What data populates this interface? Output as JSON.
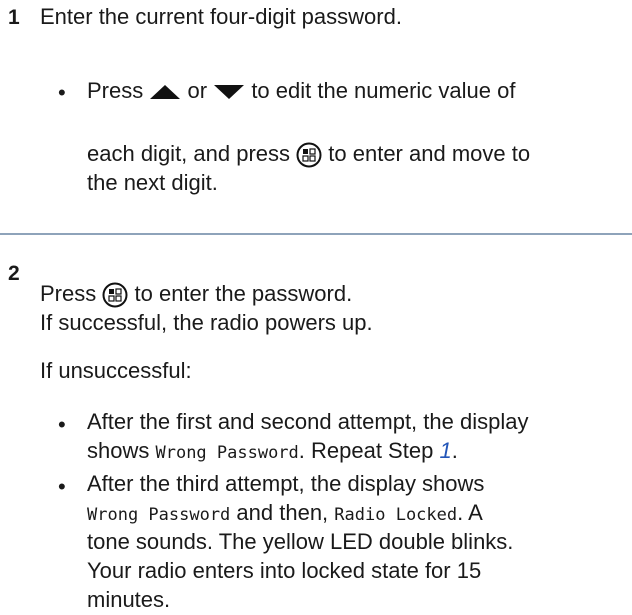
{
  "step1": {
    "number": "1",
    "instruction": "Enter the current four-digit password.",
    "bullet": {
      "press": "Press",
      "or": "or",
      "line1_tail": "to edit the numeric value of",
      "line2_head": "each digit, and press",
      "line2_tail": "to enter and move to",
      "line3": "the next digit."
    }
  },
  "step2": {
    "number": "2",
    "press": "Press",
    "press_tail": "to enter the password.",
    "success": "If successful, the radio powers up.",
    "unsuccessful": "If unsuccessful:",
    "bullet1": {
      "line1": "After the first and second attempt, the display",
      "shows": "shows",
      "display_text": "Wrong Password",
      "repeat": ". Repeat Step",
      "step_ref": "1",
      "period": "."
    },
    "bullet2": {
      "line1": "After the third attempt, the display shows",
      "display_text1": "Wrong Password",
      "and_then": "and then,",
      "display_text2": "Radio Locked",
      "tail": ". A",
      "line3": "tone sounds. The yellow LED double blinks.",
      "line4": "Your radio enters into locked state for 15",
      "line5": "minutes."
    }
  },
  "icons": {
    "up": "arrow-up-icon",
    "down": "arrow-down-icon",
    "menu": "menu-ok-button-icon"
  },
  "colors": {
    "rule": "#8ea3ba",
    "link": "#2356b8"
  }
}
